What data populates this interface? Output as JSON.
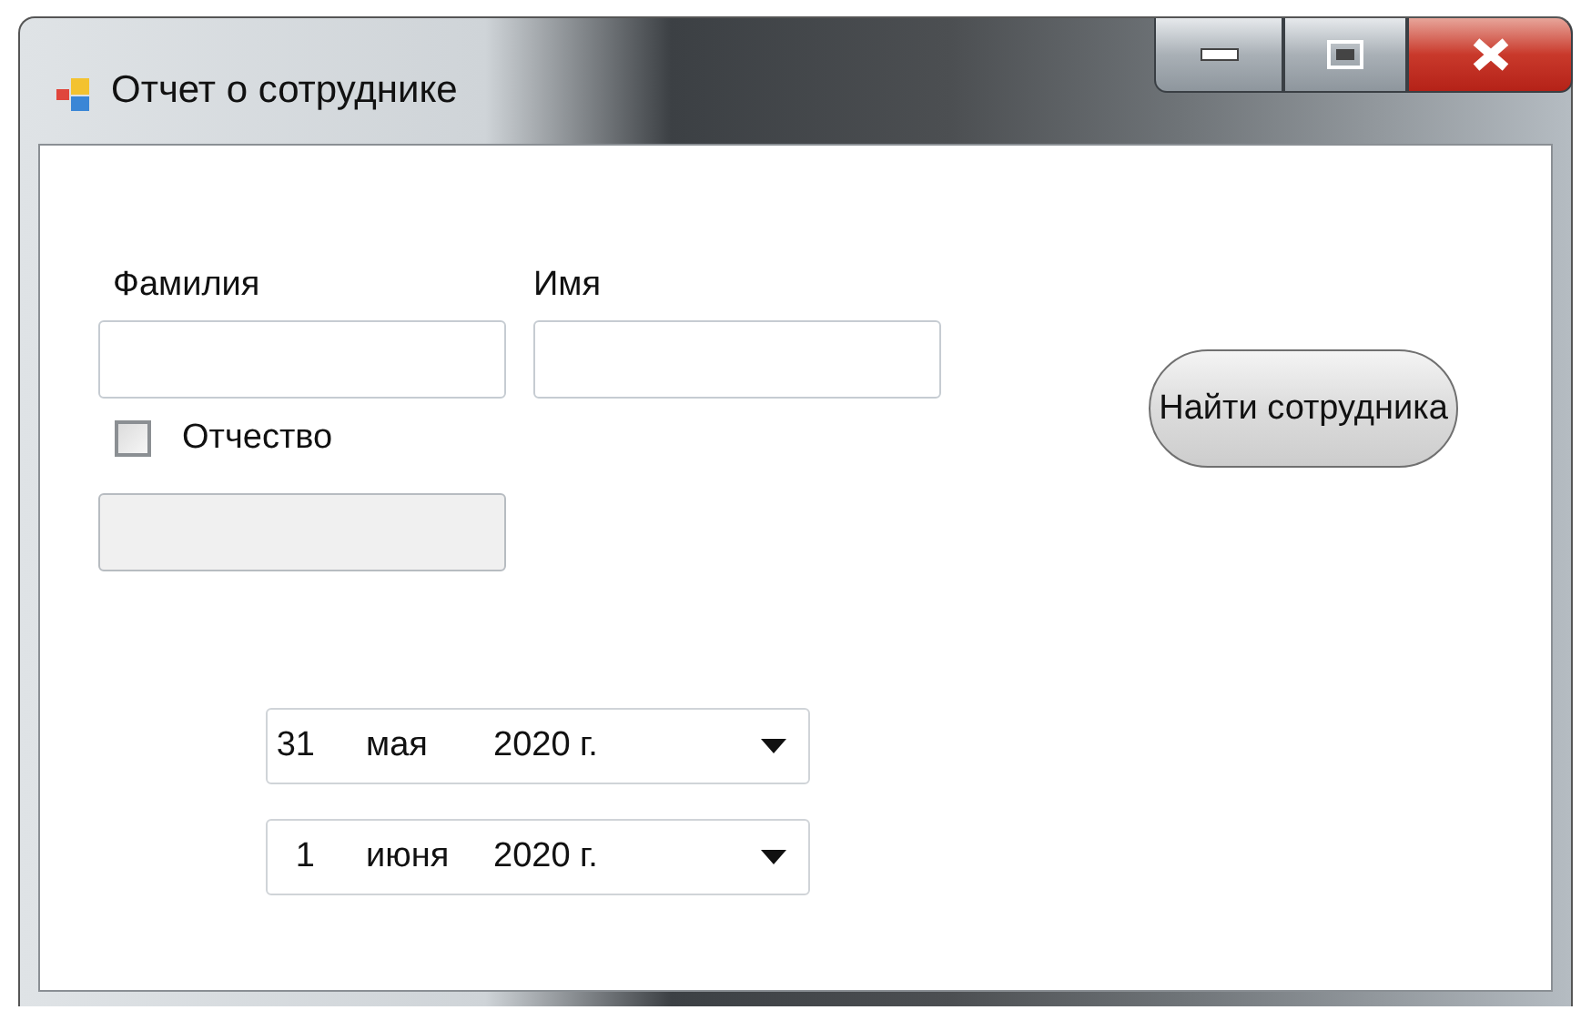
{
  "window": {
    "title": "Отчет о сотруднике"
  },
  "fields": [
    {
      "label": "Фамилия"
    },
    {
      "label": "Имя"
    }
  ],
  "patronymic": {
    "label": "Отчество",
    "checked": false
  },
  "patronymic_field": {
    "disabled": true
  },
  "find_button": {
    "label": "Найти сотрудника"
  },
  "dates": [
    {
      "day": "31",
      "month": "мая",
      "year": "2020 г."
    },
    {
      "day": "1",
      "month": "июня",
      "year": "2020 г."
    }
  ]
}
